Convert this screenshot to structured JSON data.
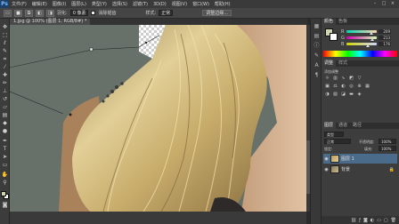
{
  "app": {
    "logo": "Ps"
  },
  "menu": [
    "文件(F)",
    "编辑(E)",
    "图像(I)",
    "图层(L)",
    "类型(Y)",
    "选择(S)",
    "滤镜(T)",
    "3D(D)",
    "视图(V)",
    "窗口(W)",
    "帮助(H)"
  ],
  "window_controls": [
    "–",
    "□",
    "×"
  ],
  "options": {
    "feather_label": "羽化:",
    "feather_value": "0 像素",
    "antialias_label": "消除锯齿",
    "style_label": "样式:",
    "style_value": "正常",
    "refine_button": "调整边缘..."
  },
  "document": {
    "tab_title": "1.jpg @ 100% (图层 1, RGB/8#) *"
  },
  "panels": {
    "color_tabs": [
      "颜色",
      "色板"
    ],
    "color_values": {
      "r": "209",
      "g": "213",
      "b": "176"
    },
    "adjust_tabs": [
      "调整",
      "样式"
    ],
    "adjust_title": "添加调整",
    "layer_tabs": [
      "图层",
      "通道",
      "路径"
    ],
    "blend_mode": "正常",
    "opacity_label": "不透明度:",
    "opacity_value": "100%",
    "lock_label": "锁定:",
    "fill_label": "填充:",
    "fill_value": "100%",
    "kind_label": "类型",
    "layers": [
      {
        "name": "图层 1",
        "selected": true
      },
      {
        "name": "背景",
        "selected": false
      }
    ]
  },
  "colors": {
    "foreground": "#d1d5b0",
    "background": "#ffffff",
    "accent": "#4b6b8a"
  },
  "icons": [
    "move-icon",
    "marquee-icon",
    "lasso-icon",
    "quick-select-icon",
    "crop-icon",
    "eyedropper-icon",
    "healing-icon",
    "brush-icon",
    "stamp-icon",
    "history-brush-icon",
    "eraser-icon",
    "gradient-icon",
    "blur-icon",
    "dodge-icon",
    "pen-icon",
    "type-icon",
    "path-select-icon",
    "shape-icon",
    "hand-icon",
    "zoom-icon"
  ]
}
